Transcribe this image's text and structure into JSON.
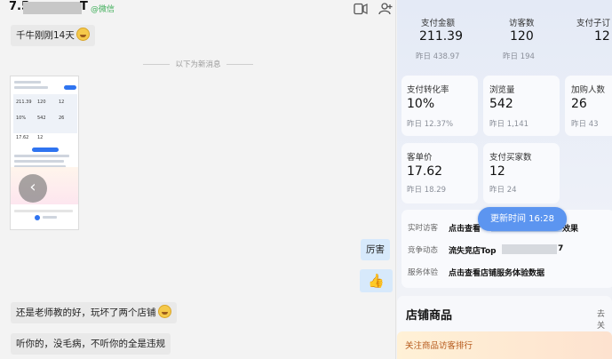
{
  "chat": {
    "title_prefix": "7.5",
    "title_suffix": "T",
    "tag": "@微信",
    "messages": [
      {
        "text": "千牛刚刚14天"
      },
      {
        "text": "厉害"
      },
      {
        "text": "还是老师教的好，玩坏了两个店铺"
      },
      {
        "text": "听你的，没毛病，不听你的全是违规"
      }
    ],
    "divider": "以下为新消息",
    "icons": [
      "phone-icon",
      "add-contact-icon",
      "back-arrow-icon",
      "thumbs-up-icon"
    ]
  },
  "dashboard": {
    "metrics": [
      {
        "label": "支付金额",
        "value": "211.39",
        "sub": "昨日 438.97"
      },
      {
        "label": "访客数",
        "value": "120",
        "sub": "昨日 194"
      },
      {
        "label": "支付子订",
        "value": "12",
        "sub": ""
      },
      {
        "label": "支付转化率",
        "value": "10%",
        "sub": "昨日 12.37%"
      },
      {
        "label": "浏览量",
        "value": "542",
        "sub": "昨日 1,141"
      },
      {
        "label": "加购人数",
        "value": "26",
        "sub": "昨日 43"
      },
      {
        "label": "客单价",
        "value": "17.62",
        "sub": "昨日 18.29"
      },
      {
        "label": "支付买家数",
        "value": "12",
        "sub": "昨日 24"
      }
    ],
    "update_time": "更新时间 16:28",
    "info_rows": [
      {
        "label": "实时访客",
        "value": "点击查看",
        "value_tail": "效果"
      },
      {
        "label": "竞争动态",
        "value": "流失竞店Top",
        "value_tail": "7"
      },
      {
        "label": "服务体验",
        "value": "点击查看店铺服务体验数据",
        "value_tail": ""
      }
    ],
    "section_title": "店铺商品",
    "section_link": "去关",
    "bottom_banner": "关注商品访客排行"
  }
}
